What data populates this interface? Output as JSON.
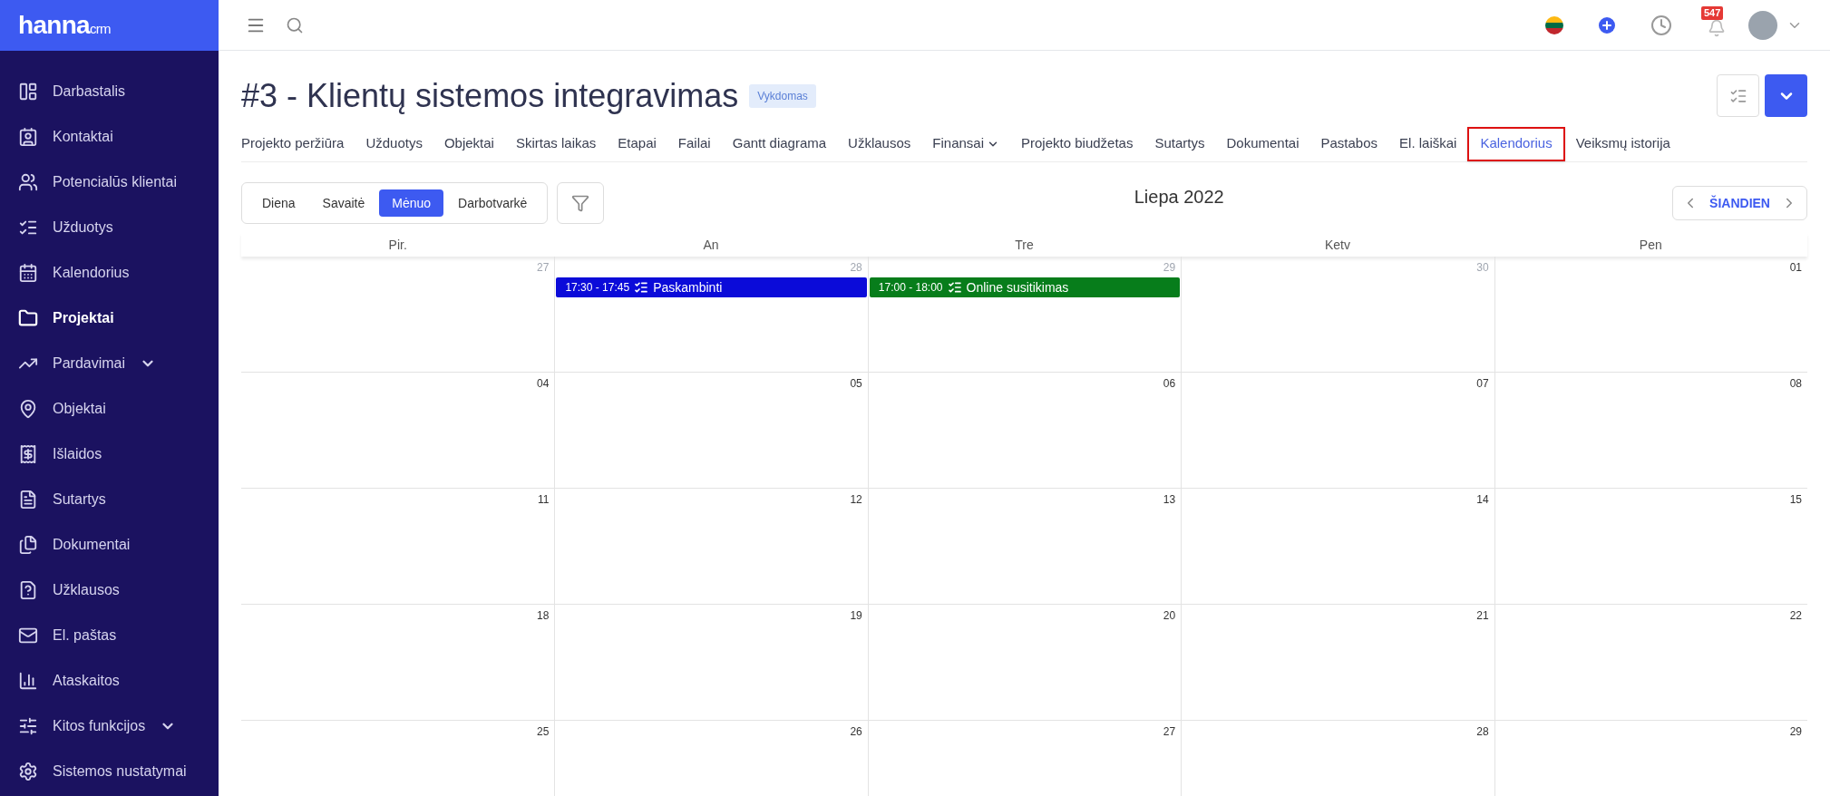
{
  "logo": {
    "name": "hanna",
    "suffix": "crm"
  },
  "sidebar": {
    "items": [
      {
        "kind": "dashboard",
        "label": "Darbastalis",
        "selected": false
      },
      {
        "kind": "contacts",
        "label": "Kontaktai",
        "selected": false
      },
      {
        "kind": "people",
        "label": "Potencialūs klientai",
        "selected": false
      },
      {
        "kind": "tasks",
        "label": "Užduotys",
        "selected": false
      },
      {
        "kind": "calendar",
        "label": "Kalendorius",
        "selected": false
      },
      {
        "kind": "folder",
        "label": "Projektai",
        "selected": true
      },
      {
        "kind": "trend",
        "label": "Pardavimai",
        "selected": false,
        "expandable": true
      },
      {
        "kind": "pin",
        "label": "Objektai",
        "selected": false
      },
      {
        "kind": "receipt",
        "label": "Išlaidos",
        "selected": false
      },
      {
        "kind": "doc",
        "label": "Sutartys",
        "selected": false
      },
      {
        "kind": "docs",
        "label": "Dokumentai",
        "selected": false
      },
      {
        "kind": "question",
        "label": "Užklausos",
        "selected": false
      },
      {
        "kind": "mail",
        "label": "El. paštas",
        "selected": false
      },
      {
        "kind": "chart",
        "label": "Ataskaitos",
        "selected": false
      },
      {
        "kind": "sliders",
        "label": "Kitos funkcijos",
        "selected": false,
        "expandable": true
      },
      {
        "kind": "settings",
        "label": "Sistemos nustatymai",
        "selected": false
      }
    ]
  },
  "topbar": {
    "notification_count": "547"
  },
  "project": {
    "title": "#3 - Klientų sistemos integravimas",
    "status": "Vykdomas"
  },
  "tabs": [
    {
      "label": "Projekto peržiūra",
      "selected": false
    },
    {
      "label": "Užduotys",
      "selected": false
    },
    {
      "label": "Objektai",
      "selected": false
    },
    {
      "label": "Skirtas laikas",
      "selected": false
    },
    {
      "label": "Etapai",
      "selected": false
    },
    {
      "label": "Failai",
      "selected": false
    },
    {
      "label": "Gantt diagrama",
      "selected": false
    },
    {
      "label": "Užklausos",
      "selected": false
    },
    {
      "label": "Finansai",
      "selected": false,
      "dropdown": true
    },
    {
      "label": "Projekto biudžetas",
      "selected": false
    },
    {
      "label": "Sutartys",
      "selected": false
    },
    {
      "label": "Dokumentai",
      "selected": false
    },
    {
      "label": "Pastabos",
      "selected": false
    },
    {
      "label": "El. laiškai",
      "selected": false
    },
    {
      "label": "Kalendorius",
      "selected": true,
      "highlighted": true
    },
    {
      "label": "Veiksmų istorija",
      "selected": false
    }
  ],
  "calendar": {
    "views": [
      {
        "label": "Diena",
        "selected": false
      },
      {
        "label": "Savaitė",
        "selected": false
      },
      {
        "label": "Mėnuo",
        "selected": true
      },
      {
        "label": "Darbotvarkė",
        "selected": false
      }
    ],
    "period": "Liepa 2022",
    "today_button": "ŠIANDIEN",
    "weekdays": [
      "Pir.",
      "An",
      "Tre",
      "Ketv",
      "Pen"
    ],
    "weeks": [
      [
        {
          "day": "27",
          "outside": true
        },
        {
          "day": "28",
          "outside": true,
          "events": [
            {
              "time": "17:30 - 17:45",
              "title": "Paskambinti",
              "color": "#0b0bd9"
            }
          ]
        },
        {
          "day": "29",
          "outside": true,
          "events": [
            {
              "time": "17:00 - 18:00",
              "title": "Online susitikimas",
              "color": "#077d1b"
            }
          ]
        },
        {
          "day": "30",
          "outside": true
        },
        {
          "day": "01",
          "outside": false
        }
      ],
      [
        {
          "day": "04",
          "outside": false
        },
        {
          "day": "05",
          "outside": false
        },
        {
          "day": "06",
          "outside": false
        },
        {
          "day": "07",
          "outside": false
        },
        {
          "day": "08",
          "outside": false
        }
      ],
      [
        {
          "day": "11",
          "outside": false
        },
        {
          "day": "12",
          "outside": false
        },
        {
          "day": "13",
          "outside": false
        },
        {
          "day": "14",
          "outside": false
        },
        {
          "day": "15",
          "outside": false
        }
      ],
      [
        {
          "day": "18",
          "outside": false
        },
        {
          "day": "19",
          "outside": false
        },
        {
          "day": "20",
          "outside": false
        },
        {
          "day": "21",
          "outside": false
        },
        {
          "day": "22",
          "outside": false
        }
      ],
      [
        {
          "day": "25",
          "outside": false
        },
        {
          "day": "26",
          "outside": false
        },
        {
          "day": "27",
          "outside": false
        },
        {
          "day": "28",
          "outside": false
        },
        {
          "day": "29",
          "outside": false
        }
      ]
    ]
  }
}
